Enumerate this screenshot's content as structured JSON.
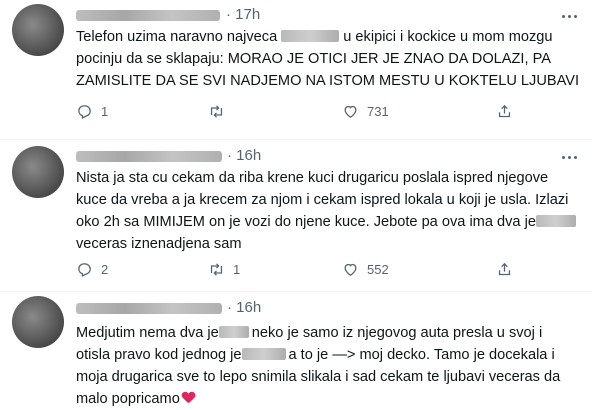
{
  "tweets": [
    {
      "time": "· 17h",
      "lines": [
        [
          "Telefon uzima naravno najveca ",
          "u ekipici i kockice u mom mozgu"
        ],
        [
          "pocinju da se sklapaju: MORAO JE OTICI JER JE ZNAO DA DOLAZI, PA"
        ],
        [
          "ZAMISLITE DA SE SVI NADJEMO NA ISTOM MESTU U KOKTELU LJUBAVI"
        ]
      ],
      "reply_count": "1",
      "retweet_count": "",
      "like_count": "731"
    },
    {
      "time": "· 16h",
      "lines": [
        [
          "Nista ja sta cu cekam da riba krene kuci drugaricu poslala ispred njegove"
        ],
        [
          "kuce da vreba a ja krecem za njom i cekam ispred lokala u koji je usla. Izlazi"
        ],
        [
          "oko 2h sa MIMIJEM on je vozi do njene kuce. Jebote pa ova ima dva je"
        ],
        [
          "veceras iznenadjena sam"
        ]
      ],
      "reply_count": "2",
      "retweet_count": "1",
      "like_count": "552"
    },
    {
      "time": "· 16h",
      "lines": [
        [
          "Medjutim nema dva je",
          "neko je samo iz njegovog auta presla u svoj i"
        ],
        [
          "otisla pravo kod jednog je",
          "a to je —> moj decko. Tamo je docekala i"
        ],
        [
          "moja drugarica sve to lepo snimila slikala i sad cekam te ljubavi veceras da"
        ],
        [
          "malo popricamo"
        ]
      ],
      "reply_count": "",
      "retweet_count": "",
      "like_count": ""
    }
  ],
  "icons": {
    "reply": "reply-icon",
    "retweet": "retweet-icon",
    "like": "heart-icon",
    "share": "share-icon",
    "more": "more-icon"
  },
  "colors": {
    "text": "#0f1419",
    "muted": "#536471",
    "heart": "#e0245e",
    "divider": "#eff3f4"
  }
}
